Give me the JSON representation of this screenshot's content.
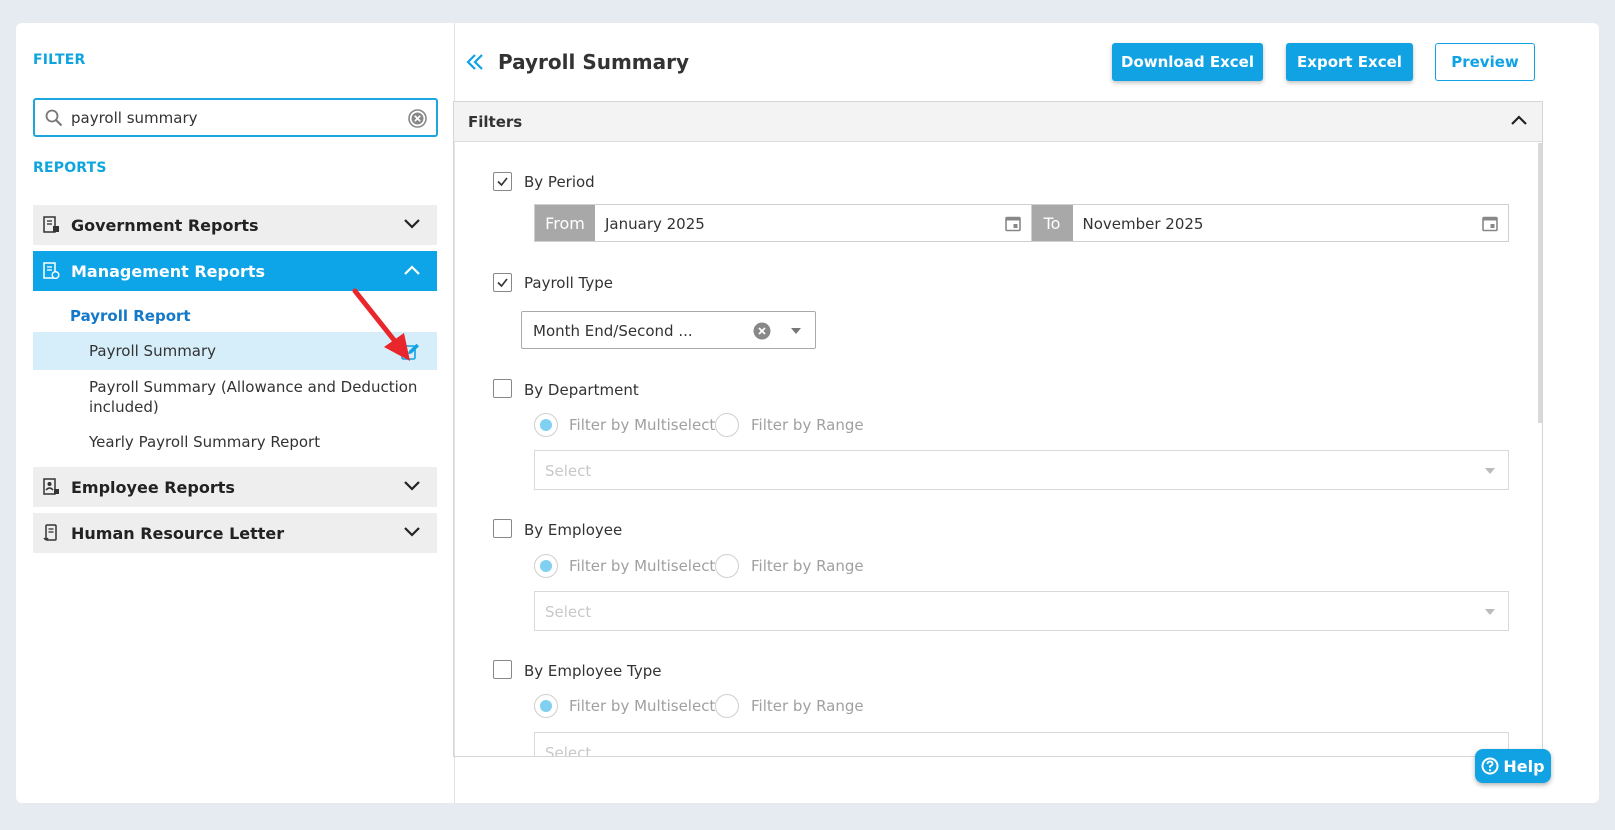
{
  "sidebar": {
    "filter_label": "FILTER",
    "search": {
      "value": "payroll summary",
      "placeholder": ""
    },
    "reports_label": "REPORTS",
    "groups": [
      {
        "label": "Government Reports",
        "expanded": false
      },
      {
        "label": "Management Reports",
        "expanded": true
      },
      {
        "label": "Employee Reports",
        "expanded": false
      },
      {
        "label": "Human Resource Letter",
        "expanded": false
      }
    ],
    "sub_heading": "Payroll Report",
    "items": [
      {
        "label": "Payroll Summary",
        "selected": true
      },
      {
        "label": "Payroll Summary (Allowance and Deduction included)",
        "selected": false
      },
      {
        "label": "Yearly Payroll Summary Report",
        "selected": false
      }
    ]
  },
  "header": {
    "title": "Payroll Summary",
    "download_label": "Download Excel",
    "export_label": "Export Excel",
    "preview_label": "Preview"
  },
  "filters": {
    "title": "Filters",
    "by_period": {
      "label": "By Period",
      "checked": true,
      "from_tag": "From",
      "from_value": "January 2025",
      "to_tag": "To",
      "to_value": "November 2025"
    },
    "payroll_type": {
      "label": "Payroll Type",
      "checked": true,
      "value": "Month End/Second ..."
    },
    "by_department": {
      "label": "By Department",
      "checked": false,
      "opt_multi": "Filter by Multiselect",
      "opt_range": "Filter by Range",
      "select_placeholder": "Select"
    },
    "by_employee": {
      "label": "By Employee",
      "checked": false,
      "opt_multi": "Filter by Multiselect",
      "opt_range": "Filter by Range",
      "select_placeholder": "Select"
    },
    "by_employee_type": {
      "label": "By Employee Type",
      "checked": false,
      "opt_multi": "Filter by Multiselect",
      "opt_range": "Filter by Range",
      "select_placeholder": "Select"
    }
  },
  "help_label": "Help",
  "colors": {
    "accent": "#11a2e4",
    "active_group": "#0ea5e8",
    "selected_item": "#d6eefa",
    "annotation_arrow": "#e8262b"
  }
}
